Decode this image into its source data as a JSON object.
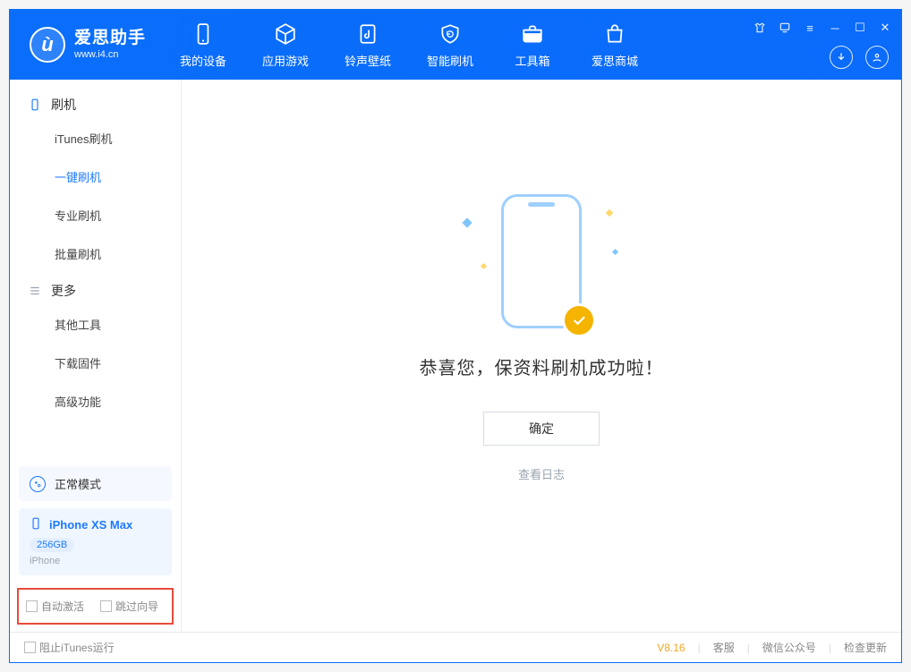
{
  "app": {
    "name": "爱思助手",
    "subdomain": "www.i4.cn"
  },
  "nav": {
    "items": [
      {
        "label": "我的设备"
      },
      {
        "label": "应用游戏"
      },
      {
        "label": "铃声壁纸"
      },
      {
        "label": "智能刷机"
      },
      {
        "label": "工具箱"
      },
      {
        "label": "爱思商城"
      }
    ]
  },
  "sidebar": {
    "group_flash": "刷机",
    "flash_items": [
      "iTunes刷机",
      "一键刷机",
      "专业刷机",
      "批量刷机"
    ],
    "active_flash_index": 1,
    "group_more": "更多",
    "more_items": [
      "其他工具",
      "下载固件",
      "高级功能"
    ]
  },
  "device": {
    "mode_label": "正常模式",
    "name": "iPhone XS Max",
    "storage": "256GB",
    "type": "iPhone"
  },
  "bottom_options": {
    "auto_activate": "自动激活",
    "skip_guide": "跳过向导"
  },
  "main": {
    "success_title": "恭喜您，保资料刷机成功啦！",
    "confirm_label": "确定",
    "log_link_label": "查看日志"
  },
  "status": {
    "block_itunes": "阻止iTunes运行",
    "version": "V8.16",
    "links": [
      "客服",
      "微信公众号",
      "检查更新"
    ]
  }
}
